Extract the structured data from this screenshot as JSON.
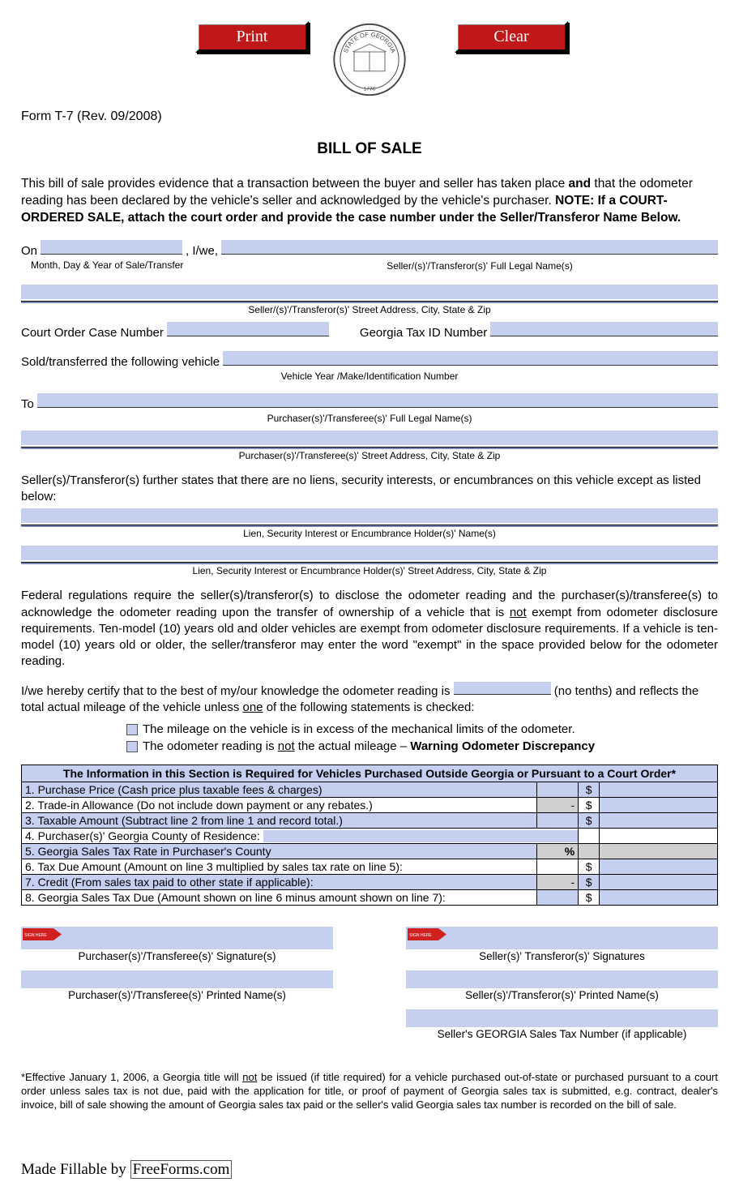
{
  "buttons": {
    "print": "Print",
    "clear": "Clear"
  },
  "form_id": "Form T-7 (Rev. 09/2008)",
  "title": "BILL OF SALE",
  "intro": {
    "p1a": "This bill of sale provides evidence that a transaction between the buyer and seller has taken place ",
    "and": "and",
    "p1b": " that the odometer reading has been declared by the vehicle's seller and acknowledged by the vehicle's purchaser.  ",
    "note_label": "NOTE:  If a COURT-ORDERED SALE, attach the court order and provide the case number under the Seller/Transferor Name Below."
  },
  "labels": {
    "on": "On",
    "iwe": ", I/we,",
    "date_caption": "Month, Day & Year of Sale/Transfer",
    "seller_name_caption": "Seller/(s)'/Transferor(s)' Full Legal Name(s)",
    "seller_addr_caption": "Seller/(s)'/Transferor(s)' Street Address, City, State & Zip",
    "court_order": "Court Order Case Number",
    "ga_tax_id": "Georgia Tax ID Number",
    "sold_vehicle": "Sold/transferred the following vehicle",
    "vehicle_caption": "Vehicle Year /Make/Identification Number",
    "to": "To",
    "purchaser_name_caption": "Purchaser(s)'/Transferee(s)' Full Legal Name(s)",
    "purchaser_addr_caption": "Purchaser(s)'/Transferee(s)' Street Address, City, State & Zip",
    "liens_intro": "Seller(s)/Transferor(s) further states that there are no liens, security interests, or encumbrances on this vehicle except as listed below:",
    "lien_name_caption": "Lien, Security Interest or Encumbrance Holder(s)' Name(s)",
    "lien_addr_caption": "Lien, Security Interest or Encumbrance Holder(s)' Street Address, City, State & Zip"
  },
  "odometer_para": {
    "p1a": "Federal regulations require the seller(s)/transferor(s) to disclose the odometer reading and the purchaser(s)/transferee(s) to acknowledge the odometer reading upon the transfer of ownership of a vehicle that is ",
    "not": "not",
    "p1b": " exempt from odometer disclosure requirements.  Ten-model (10) years old and older vehicles are exempt from odometer disclosure requirements.  If a vehicle is ten-model (10) years old or older, the seller/transferor may enter the word \"exempt\" in the space provided below for the odometer reading."
  },
  "certify": {
    "a": "I/we hereby certify that to the best of my/our knowledge the odometer reading is ",
    "b": " (no tenths) and reflects the total actual mileage of the vehicle unless ",
    "one": "one",
    "c": " of the following statements is checked:"
  },
  "checks": {
    "c1": "The mileage on the vehicle is in excess of the mechanical limits of the odometer.",
    "c2a": "The odometer reading is ",
    "c2_not": "not",
    "c2b": " the actual mileage – ",
    "c2_warn": "Warning Odometer Discrepancy"
  },
  "table": {
    "header": "The Information in this Section is Required for Vehicles Purchased Outside Georgia or Pursuant to a Court Order*",
    "rows": [
      {
        "label": "1. Purchase Price (Cash price plus taxable fees & charges)",
        "sign": "",
        "dollar": "$"
      },
      {
        "label": "2. Trade-in Allowance (Do not include down payment or any rebates.)",
        "sign": "-",
        "dollar": "$"
      },
      {
        "label": "3. Taxable Amount (Subtract line 2 from line 1 and record total.)",
        "sign": "",
        "dollar": "$"
      },
      {
        "label": "4. Purchaser(s)' Georgia County of Residence:",
        "sign": "",
        "dollar": ""
      },
      {
        "label": "5. Georgia Sales Tax Rate in Purchaser's County",
        "sign": "%",
        "dollar": ""
      },
      {
        "label": "6. Tax Due Amount (Amount on line 3 multiplied by sales tax rate on line 5):",
        "sign": "",
        "dollar": "$"
      },
      {
        "label": "7.  Credit (From sales tax paid to other state if applicable):",
        "sign": "-",
        "dollar": "$"
      },
      {
        "label": "8.  Georgia Sales Tax Due (Amount shown on line 6 minus amount shown on line 7):",
        "sign": "",
        "dollar": "$"
      }
    ]
  },
  "sigs": {
    "p_sig": "Purchaser(s)'/Transferee(s)' Signature(s)",
    "p_name": "Purchaser(s)'/Transferee(s)' Printed Name(s)",
    "s_sig": "Seller(s)' Transferor(s)' Signatures",
    "s_name": "Seller(s)'/Transferor(s)' Printed Name(s)",
    "s_tax": "Seller's GEORGIA Sales Tax Number (if applicable)"
  },
  "footnote": {
    "a": "*Effective January 1, 2006, a Georgia title will ",
    "not": "not",
    "b": " be issued (if title required) for a vehicle purchased out-of-state or purchased pursuant to a court order unless sales tax is not due, paid with the application for title, or proof of payment of Georgia sales tax is submitted, e.g. contract, dealer's invoice, bill of sale showing the amount of Georgia sales tax paid or the seller's valid Georgia sales tax number is recorded on the bill of sale."
  },
  "footer": {
    "a": "Made Fillable by ",
    "link": "FreeForms.com"
  }
}
